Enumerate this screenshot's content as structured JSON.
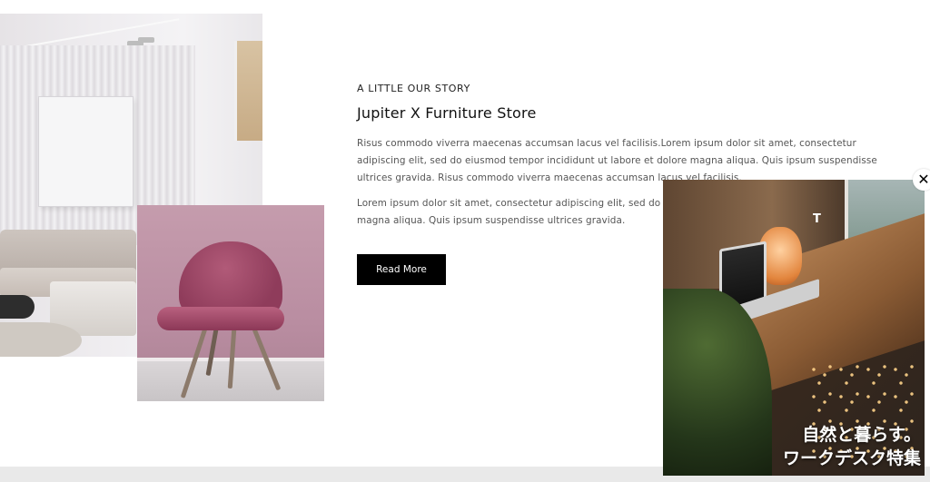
{
  "story": {
    "kicker": "A LITTLE OUR STORY",
    "title": "Jupiter X Furniture Store",
    "paragraph_1": "Risus commodo viverra maecenas accumsan lacus vel facilisis.Lorem ipsum dolor sit amet, consectetur adipiscing elit, sed do eiusmod tempor incididunt ut labore et dolore magna aliqua. Quis ipsum suspendisse ultrices gravida. Risus commodo viverra maecenas accumsan lacus vel facilisis.",
    "paragraph_2": "Lorem ipsum dolor sit amet, consectetur adipiscing elit, sed do eiusmod tempor incididunt ut labore et dolore magna aliqua. Quis ipsum suspendisse ultrices gravida.",
    "button_label": "Read More"
  },
  "images": {
    "room": "living-room-with-sofa-and-framed-canvas",
    "chair": "pink-velvet-chair"
  },
  "ad": {
    "image": "wooden-desk-with-laptop-salt-lamp-and-plants",
    "logo": "T",
    "headline_line_1": "自然と暮らす。",
    "headline_line_2": "ワークデスク特集",
    "close_label": "✕"
  },
  "colors": {
    "button_bg": "#000000",
    "bottom_band": "#e9e9e9",
    "chair_wall": "#c59cad"
  }
}
